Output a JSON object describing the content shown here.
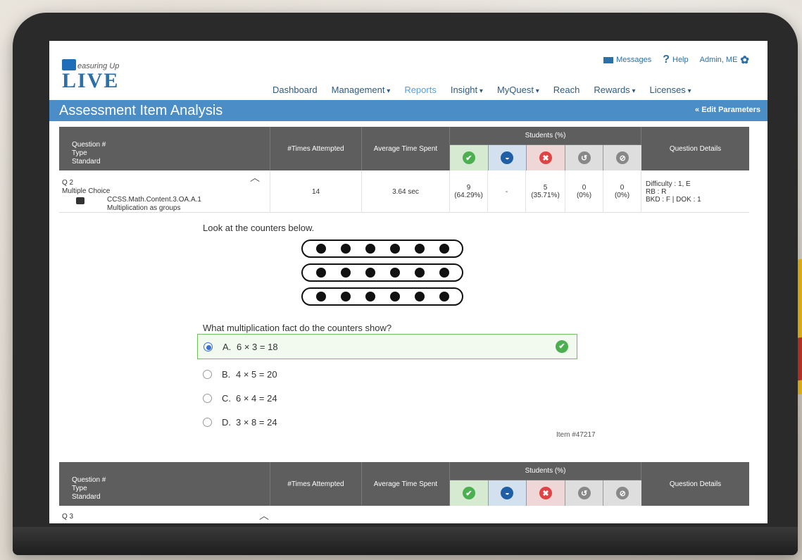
{
  "app": {
    "logo_small": "easuring Up",
    "logo_big": "LIVE"
  },
  "utility": {
    "messages": "Messages",
    "help": "Help",
    "admin": "Admin, ME"
  },
  "nav": [
    "Dashboard",
    "Management",
    "Reports",
    "Insight",
    "MyQuest",
    "Reach",
    "Rewards",
    "Licenses"
  ],
  "nav_active_index": 2,
  "page": {
    "title": "Assessment Item Analysis",
    "edit_parameters": "Edit Parameters"
  },
  "table_header": {
    "question": "Question #",
    "type": "Type",
    "standard": "Standard",
    "times_attempted": "#Times Attempted",
    "avg_time": "Average Time Spent",
    "students": "Students (%)",
    "question_details": "Question Details"
  },
  "student_icons": [
    {
      "name": "correct-icon",
      "glyph": "✔",
      "color": "#4caf50"
    },
    {
      "name": "partial-icon",
      "glyph": "◒",
      "color": "#1f5fa8"
    },
    {
      "name": "incorrect-icon",
      "glyph": "✖",
      "color": "#e04343"
    },
    {
      "name": "retry-icon",
      "glyph": "↺",
      "color": "#666666"
    },
    {
      "name": "skipped-icon",
      "glyph": "⊘",
      "color": "#666666"
    }
  ],
  "row1": {
    "question": "Q 2",
    "type": "Multiple Choice",
    "standard": "CCSS.Math.Content.3.OA.A.1",
    "standard_desc": "Multiplication as groups",
    "times_attempted": "14",
    "avg_time": "3.64 sec",
    "students": [
      {
        "count": "9",
        "pct": "(64.29%)"
      },
      {
        "count": "-",
        "pct": ""
      },
      {
        "count": "5",
        "pct": "(35.71%)"
      },
      {
        "count": "0",
        "pct": "(0%)"
      },
      {
        "count": "0",
        "pct": "(0%)"
      }
    ],
    "details": [
      "Difficulty : 1, E",
      "RB : R",
      "BKD : F | DOK : 1"
    ]
  },
  "question": {
    "prompt": "Look at the counters below.",
    "counter_rows": 3,
    "counters_per_row": 6,
    "stem": "What multiplication fact do the counters show?",
    "options": [
      {
        "letter": "A.",
        "text": "6 × 3 = 18",
        "selected": true,
        "correct": true
      },
      {
        "letter": "B.",
        "text": "4 × 5 = 20",
        "selected": false,
        "correct": false
      },
      {
        "letter": "C.",
        "text": "6 × 4 = 24",
        "selected": false,
        "correct": false
      },
      {
        "letter": "D.",
        "text": "3 × 8 = 24",
        "selected": false,
        "correct": false
      }
    ],
    "item_number": "Item #47217"
  },
  "row2": {
    "question": "Q 3"
  }
}
